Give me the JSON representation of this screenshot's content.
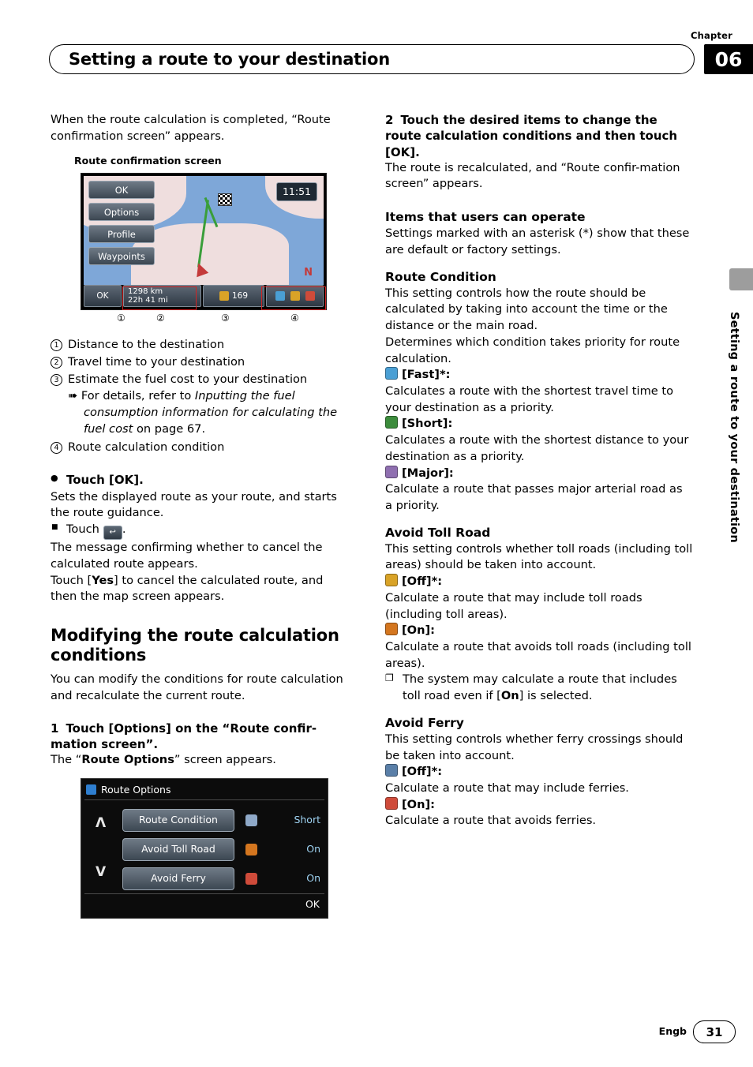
{
  "header": {
    "chapter_label": "Chapter",
    "chapter_number": "06",
    "title": "Setting a route to your destination"
  },
  "side_tab_text": "Setting a route to your destination",
  "left_column": {
    "intro": "When the route calculation is completed, “Route confirmation screen” appears.",
    "figure_caption": "Route confirmation screen",
    "nav_screen": {
      "buttons": [
        "OK",
        "Options",
        "Profile",
        "Waypoints"
      ],
      "clock": "11:51",
      "compass": "N",
      "distance": "1298 km",
      "travel_time": "22h 41 mi",
      "fuel_cost": "169"
    },
    "callouts": [
      "①",
      "②",
      "③",
      "④"
    ],
    "legend": [
      "Distance to the destination",
      "Travel time to your destination",
      "Estimate the fuel cost to your destination",
      "Route calculation condition"
    ],
    "legend_note_prefix": "For details, refer to ",
    "legend_note_italic": "Inputting the fuel consumption information for calculating the fuel cost",
    "legend_note_suffix": " on page 67.",
    "touch_ok_head": "Touch [OK].",
    "touch_ok_body": "Sets the displayed route as your route, and starts the route guidance.",
    "touch_back_label": "Touch",
    "touch_back_key": "↩",
    "touch_back_body": "The message confirming whether to cancel the calculated route appears.",
    "touch_yes_pre": "Touch [",
    "touch_yes_bold": "Yes",
    "touch_yes_post": "] to cancel the calculated route, and then the map screen appears.",
    "section_title": "Modifying the route calculation conditions",
    "section_body": "You can modify the conditions for route calculation and recalculate the current route.",
    "step1_num": "1",
    "step1_text": "Touch [Options] on the “Route confir-mation screen”.",
    "step1_after_pre": "The “",
    "step1_after_bold": "Route Options",
    "step1_after_post": "” screen appears.",
    "route_options_screen": {
      "title": "Route Options",
      "rows": [
        {
          "label": "Route Condition",
          "value": "Short",
          "icon_color": "#8fa9c8"
        },
        {
          "label": "Avoid Toll Road",
          "value": "On",
          "icon_color": "#d4761f"
        },
        {
          "label": "Avoid Ferry",
          "value": "On",
          "icon_color": "#cf4b3a"
        }
      ],
      "ok_label": "OK",
      "scroll_up": "Λ",
      "scroll_down": "V"
    }
  },
  "right_column": {
    "step2_num": "2",
    "step2_text": "Touch the desired items to change the route calculation conditions and then touch [OK].",
    "step2_body": "The route is recalculated, and “Route confir-mation screen” appears.",
    "items_heading": "Items that users can operate",
    "items_body": "Settings marked with an asterisk (*) show that these are default or factory settings.",
    "route_condition_heading": "Route Condition",
    "route_condition_body1": "This setting controls how the route should be calculated by taking into account the time or the distance or the main road.",
    "route_condition_body2": "Determines which condition takes priority for route calculation.",
    "route_condition_options": [
      {
        "label": "[Fast]*:",
        "icon_color": "#4a9fd4",
        "body": "Calculates a route with the shortest travel time to your destination as a priority."
      },
      {
        "label": "[Short]:",
        "icon_color": "#3c8c3c",
        "body": "Calculates a route with the shortest distance to your destination as a priority."
      },
      {
        "label": "[Major]:",
        "icon_color": "#8f6fb0",
        "body": "Calculate a route that passes major arterial road as a priority."
      }
    ],
    "avoid_toll_heading": "Avoid Toll Road",
    "avoid_toll_body": "This setting controls whether toll roads (including toll areas) should be taken into account.",
    "avoid_toll_options": [
      {
        "label": "[Off]*:",
        "icon_color": "#d9a327",
        "body": "Calculate a route that may include toll roads (including toll areas)."
      },
      {
        "label": "[On]:",
        "icon_color": "#d4761f",
        "body": "Calculate a route that avoids toll roads (including toll areas)."
      }
    ],
    "avoid_toll_note_pre": "The system may calculate a route that includes toll road even if [",
    "avoid_toll_note_bold": "On",
    "avoid_toll_note_post": "] is selected.",
    "avoid_ferry_heading": "Avoid Ferry",
    "avoid_ferry_body": "This setting controls whether ferry crossings should be taken into account.",
    "avoid_ferry_options": [
      {
        "label": "[Off]*:",
        "icon_color": "#5a7fa8",
        "body": "Calculate a route that may include ferries."
      },
      {
        "label": "[On]:",
        "icon_color": "#cf4b3a",
        "body": "Calculate a route that avoids ferries."
      }
    ]
  },
  "footer": {
    "language": "Engb",
    "page_number": "31"
  }
}
